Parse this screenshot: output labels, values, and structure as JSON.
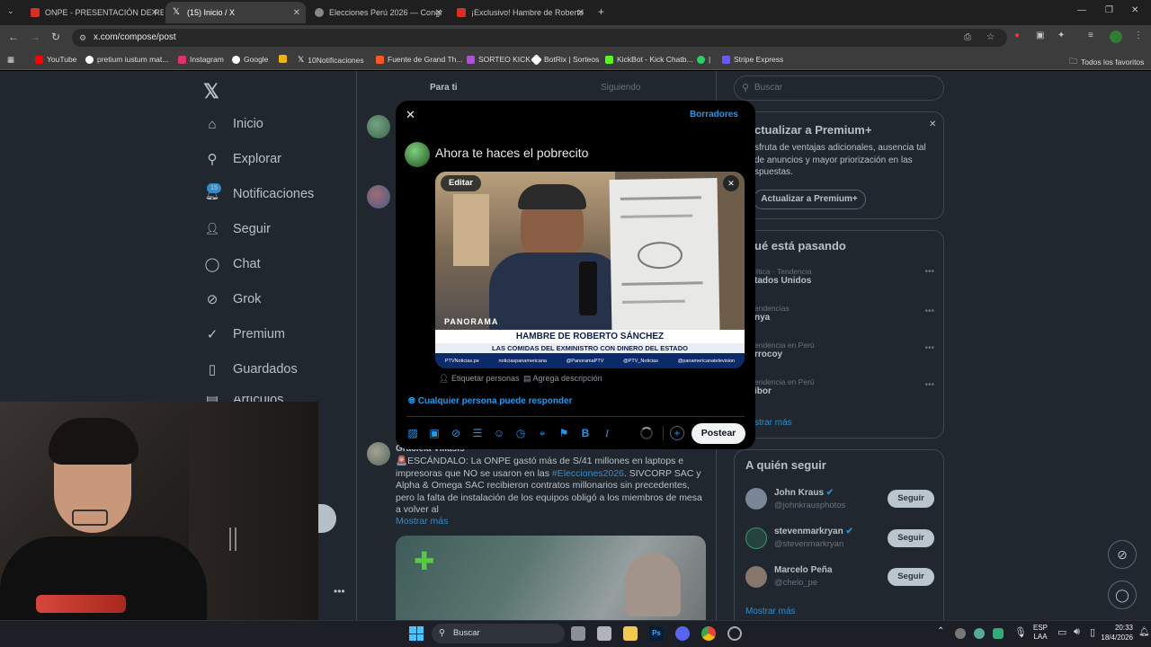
{
  "browser": {
    "tabs": [
      {
        "title": "ONPE - PRESENTACIÓN DE RES",
        "color": "#d93025"
      },
      {
        "title": "(15) Inicio / X",
        "color": "#ffffff"
      },
      {
        "title": "Elecciones Perú 2026 — Congr",
        "color": "#bbbbbb"
      },
      {
        "title": "¡Exclusivo! Hambre de Roberto",
        "color": "#d93025"
      }
    ],
    "url": "x.com/compose/post",
    "bookmarks": [
      {
        "label": "YouTube",
        "color": "#ff0000"
      },
      {
        "label": "pretium iustum mat...",
        "color": "#ffffff"
      },
      {
        "label": "Instagram",
        "color": "#e1306c"
      },
      {
        "label": "Google",
        "color": "#ffffff"
      },
      {
        "label": "",
        "color": "#f4b400"
      },
      {
        "label": "10Notificaciones",
        "color": "#ffffff"
      },
      {
        "label": "Fuente de Grand Th...",
        "color": "#ff5722"
      },
      {
        "label": "SORTEO KICK",
        "color": "#b14fd8"
      },
      {
        "label": "BotRix | Sorteos",
        "color": "#ffffff"
      },
      {
        "label": "KickBot - Kick Chatb...",
        "color": "#53fc18"
      },
      {
        "label": "|",
        "color": "#25d366"
      },
      {
        "label": "Stripe Express",
        "color": "#635bff"
      }
    ],
    "all_bookmarks": "Todos los favoritos"
  },
  "x": {
    "nav": [
      {
        "label": "Inicio",
        "icon": "home-icon",
        "glyph": "⌂"
      },
      {
        "label": "Explorar",
        "icon": "search-icon",
        "glyph": "⚲"
      },
      {
        "label": "Notificaciones",
        "icon": "bell-icon",
        "glyph": "🔔︎"
      },
      {
        "label": "Seguir",
        "icon": "add-person-icon",
        "glyph": "👤︎"
      },
      {
        "label": "Chat",
        "icon": "chat-icon",
        "glyph": "◯"
      },
      {
        "label": "Grok",
        "icon": "grok-icon",
        "glyph": "⊘"
      },
      {
        "label": "Premium",
        "icon": "premium-icon",
        "glyph": "✓"
      },
      {
        "label": "Guardados",
        "icon": "bookmark-icon",
        "glyph": "▯"
      },
      {
        "label": "Artículos",
        "icon": "article-icon",
        "glyph": "▤"
      }
    ],
    "notif_badge": "15",
    "feed_tabs": {
      "for_you": "Para ti",
      "following": "Siguiendo"
    },
    "search_placeholder": "Buscar",
    "premium": {
      "title": "ctualizar a Premium+",
      "body": "sfruta de ventajas adicionales, ausencia tal de anuncios y mayor priorización en las spuestas.",
      "button": "Actualizar a Premium+"
    },
    "trends": {
      "title": "ué está pasando",
      "items": [
        {
          "context": "lítica · Tendencia",
          "name": "tados Unidos"
        },
        {
          "context": "endencias",
          "name": "nya"
        },
        {
          "context": "endencia en Perú",
          "name": "rrocoy"
        },
        {
          "context": "endencia en Perú",
          "name": "ibor"
        }
      ],
      "show_more": "strar más"
    },
    "who_to_follow": {
      "title": "A quién seguir",
      "users": [
        {
          "name": "John Kraus",
          "handle": "@johnkrausphotos",
          "verified": true
        },
        {
          "name": "stevenmarkryan",
          "handle": "@stevenmarkryan",
          "verified": true
        },
        {
          "name": "Marcelo Peña",
          "handle": "@chelo_pe",
          "verified": false
        }
      ],
      "follow_label": "Seguir",
      "show_more": "Mostrar más"
    },
    "post": {
      "author": "Graciela Villasís",
      "text": "🚨ESCÁNDALO: La ONPE gastó más de S/41 millones en laptops e impresoras que NO se usaron en las ",
      "hashtag": "#Elecciones2026",
      "text2": ". SIVCORP SAC y Alpha & Omega SAC recibieron contratos millonarios sin precedentes, pero la falta de instalación de los equipos obligó a los miembros de mesa a volver al",
      "show_more": "Mostrar más"
    }
  },
  "compose": {
    "drafts": "Borradores",
    "text": "Ahora te haces el pobrecito",
    "edit": "Editar",
    "media": {
      "logo": "PANORAMA",
      "headline": "HAMBRE DE ROBERTO SÁNCHEZ",
      "subheadline": "LAS COMIDAS DEL EXMINISTRO CON DINERO DEL ESTADO",
      "socials": [
        "PTVNoticias.pe",
        "noticiaspanamericana",
        "@PanoramaPTV",
        "@PTV_Noticias",
        "@panamericanatelevision"
      ]
    },
    "tag_people": "Etiquetar personas",
    "add_description": "Agrega descripción",
    "reply_setting": "Cualquier persona puede responder",
    "post_button": "Postear"
  },
  "taskbar": {
    "search": "Buscar",
    "lang1": "ESP",
    "lang2": "LAA",
    "time": "20:33",
    "date": "18/4/2026"
  }
}
